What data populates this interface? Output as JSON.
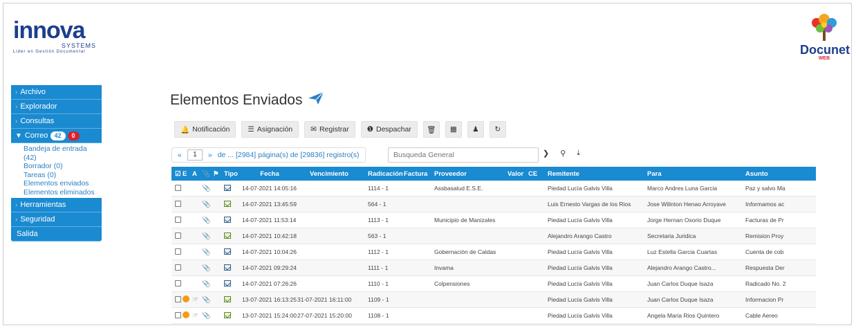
{
  "header": {
    "logo_left": {
      "brand": "innova",
      "sub": "SYSTEMS",
      "tagline": "Lider en Gestión Documental"
    },
    "logo_right": {
      "word": "Docunet",
      "sub": "WEB"
    }
  },
  "sidebar": {
    "items": [
      {
        "label": "Archivo"
      },
      {
        "label": "Explorador"
      },
      {
        "label": "Consultas"
      },
      {
        "label": "Correo",
        "badge_blue": "42",
        "badge_red": "0"
      }
    ],
    "correo_sub": [
      "Bandeja de entrada (42)",
      "Borrador (0)",
      "Tareas (0)",
      "Elementos enviados",
      "Elementos eliminados"
    ],
    "items_after": [
      {
        "label": "Herramientas"
      },
      {
        "label": "Seguridad"
      }
    ],
    "salida": "Salida"
  },
  "main": {
    "title": "Elementos Enviados",
    "toolbar": {
      "notificacion": "Notificación",
      "asignacion": "Asignación",
      "registrar": "Registrar",
      "despachar": "Despachar"
    },
    "pager": {
      "prev": "«",
      "page": "1",
      "next": "»",
      "info": "de ... [2984] página(s) de [29836] registro(s)"
    },
    "search": {
      "placeholder": "Busqueda General"
    }
  },
  "table": {
    "headers": {
      "e": "E",
      "a": "A",
      "tipo": "Tipo",
      "fecha": "Fecha",
      "vencimiento": "Vencimiento",
      "radicacion": "Radicación",
      "factura": "Factura",
      "proveedor": "Proveedor",
      "valor": "Valor",
      "ce": "CE",
      "remitente": "Remitente",
      "para": "Para",
      "asunto": "Asunto"
    },
    "rows": [
      {
        "fecha": "14-07-2021 14:05:16",
        "venc": "",
        "rad": "1114 - 1",
        "prov": "Assbasalud E.S.E.",
        "rem": "Piedad Lucía Galvis Villa",
        "para": "Marco Andres Luna Garcia",
        "asunto": "Paz y salvo Ma",
        "dot": false,
        "tipo_green": false
      },
      {
        "fecha": "14-07-2021 13:45:59",
        "venc": "",
        "rad": "564 - 1",
        "prov": "",
        "rem": "Luis Ernesto Vargas de los Rios",
        "para": "Jose Wilinton Henao Arroyave",
        "asunto": "Informamos ac",
        "dot": false,
        "tipo_green": true
      },
      {
        "fecha": "14-07-2021 11:53:14",
        "venc": "",
        "rad": "1113 - 1",
        "prov": "Municipio de Manizales",
        "rem": "Piedad Lucía Galvis Villa",
        "para": "Jorge Hernan Osorio Duque",
        "asunto": "Facturas de Pr",
        "dot": false,
        "tipo_green": false
      },
      {
        "fecha": "14-07-2021 10:42:18",
        "venc": "",
        "rad": "563 - 1",
        "prov": "",
        "rem": "Alejandro Arango Castro",
        "para": "Secretaria Juridica",
        "asunto": "Remision Proy",
        "dot": false,
        "tipo_green": true
      },
      {
        "fecha": "14-07-2021 10:04:26",
        "venc": "",
        "rad": "1112 - 1",
        "prov": "Gobernación de Caldas",
        "rem": "Piedad Lucía Galvis Villa",
        "para": "Luz Estella Garcia Cuartas",
        "asunto": "Cuenta de cob",
        "dot": false,
        "tipo_green": false
      },
      {
        "fecha": "14-07-2021 09:29:24",
        "venc": "",
        "rad": "1111 - 1",
        "prov": "Invama",
        "rem": "Piedad Lucía Galvis Villa",
        "para": "Alejandro Arango Castro...",
        "asunto": "Respuesta Der",
        "dot": false,
        "tipo_green": false
      },
      {
        "fecha": "14-07-2021 07:26:26",
        "venc": "",
        "rad": "1110 - 1",
        "prov": "Colpensiones",
        "rem": "Piedad Lucía Galvis Villa",
        "para": "Juan Carlos Duque Isaza",
        "asunto": "Radicado No. 2",
        "dot": false,
        "tipo_green": false
      },
      {
        "fecha": "13-07-2021 16:13:25",
        "venc": "31-07-2021 16:11:00",
        "rad": "1109 - 1",
        "prov": "",
        "rem": "Piedad Lucía Galvis Villa",
        "para": "Juan Carlos Duque Isaza",
        "asunto": "Informacion Pr",
        "dot": true,
        "tipo_green": true
      },
      {
        "fecha": "13-07-2021 15:24:00",
        "venc": "27-07-2021 15:20:00",
        "rad": "1108 - 1",
        "prov": "",
        "rem": "Piedad Lucía Galvis Villa",
        "para": "Angela Maria Rios Quintero",
        "asunto": "Cable Aereo",
        "dot": true,
        "tipo_green": true
      }
    ]
  }
}
